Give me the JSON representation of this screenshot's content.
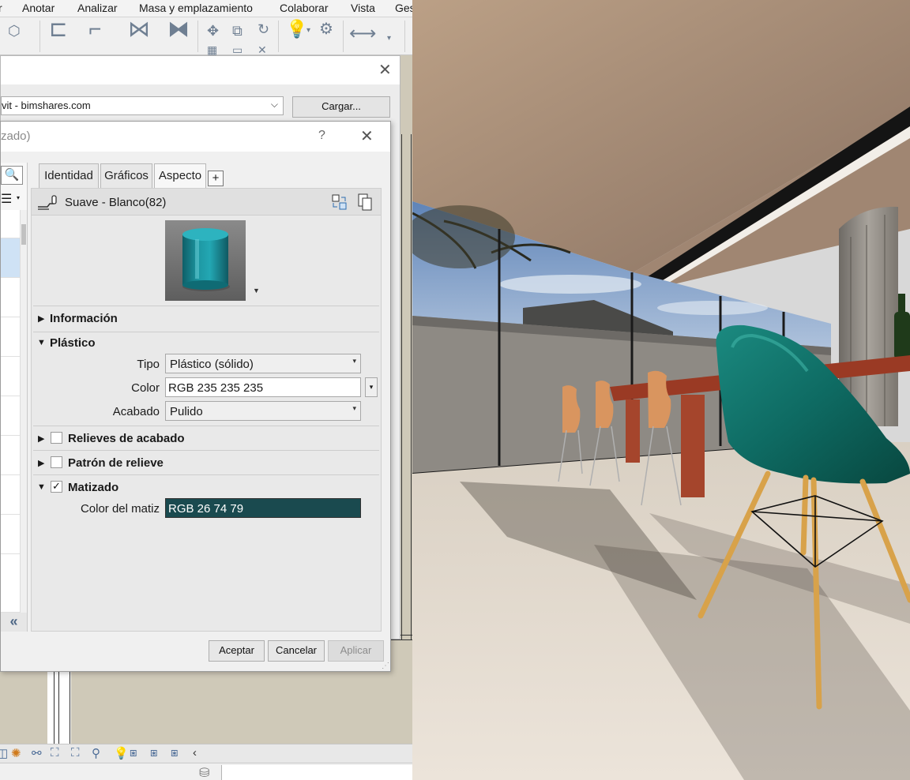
{
  "menu": [
    "r",
    "Anotar",
    "Analizar",
    "Masa y emplazamiento",
    "Colaborar",
    "Vista",
    "Ges"
  ],
  "browser": {
    "library": "vit - bimshares.com",
    "load_button": "Cargar..."
  },
  "editor": {
    "title": "zado)",
    "help": "?",
    "tabs": [
      "Identidad",
      "Gráficos",
      "Aspecto"
    ],
    "tab_add": "+",
    "material_name": "Suave - Blanco(82)",
    "sections": {
      "informacion": "Información",
      "plastico": "Plástico",
      "relieves": "Relieves de acabado",
      "patron": "Patrón de relieve",
      "matizado": "Matizado"
    },
    "props": {
      "tipo_label": "Tipo",
      "tipo_value": "Plástico (sólido)",
      "color_label": "Color",
      "color_value": "RGB 235 235 235",
      "acabado_label": "Acabado",
      "acabado_value": "Pulido",
      "matiz_label": "Color del matiz",
      "matiz_value": "RGB 26 74 79",
      "matiz_swatch": "#1a4a4f"
    },
    "checkboxes": {
      "relieves": false,
      "patron": false,
      "matizado": true
    },
    "buttons": {
      "accept": "Aceptar",
      "cancel": "Cancelar",
      "apply": "Aplicar"
    }
  },
  "colors": {
    "preview_teal": "#1d8a95",
    "chair_teal": "#0f6a64"
  }
}
